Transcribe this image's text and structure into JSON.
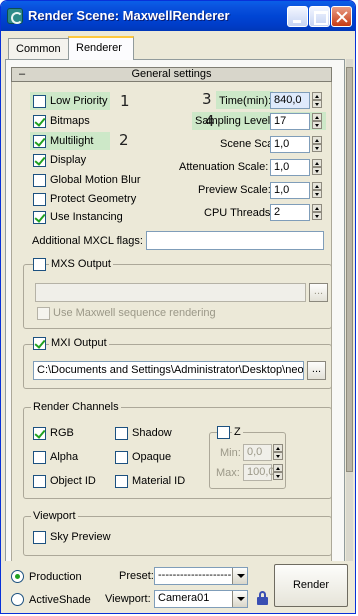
{
  "window": {
    "title": "Render Scene: MaxwellRenderer"
  },
  "tabs": [
    "Common",
    "Renderer"
  ],
  "rollout": {
    "collapse_symbol": "–",
    "title": "General settings"
  },
  "general": {
    "checkboxes": [
      {
        "label": "Low Priority",
        "checked": false
      },
      {
        "label": "Bitmaps",
        "checked": true
      },
      {
        "label": "Multilight",
        "checked": true
      },
      {
        "label": "Display",
        "checked": true
      },
      {
        "label": "Global Motion Blur",
        "checked": false
      },
      {
        "label": "Protect Geometry",
        "checked": false
      },
      {
        "label": "Use Instancing",
        "checked": true
      }
    ],
    "annotations": [
      "1",
      "2",
      "3",
      "4"
    ],
    "params": [
      {
        "label": "Time(min):",
        "value": "840,0"
      },
      {
        "label": "Sampling Level:",
        "value": "17"
      },
      {
        "label": "Scene Scale:",
        "value": "1,0"
      },
      {
        "label": "Attenuation Scale:",
        "value": "1,0"
      },
      {
        "label": "Preview Scale:",
        "value": "1,0"
      },
      {
        "label": "CPU Threads:",
        "value": "2"
      }
    ],
    "mxcl_label": "Additional MXCL flags:",
    "mxcl_value": ""
  },
  "mxs": {
    "label": "MXS Output",
    "checked": false,
    "path": "",
    "browse": "...",
    "sequence_label": "Use Maxwell sequence rendering"
  },
  "mxi": {
    "label": "MXI Output",
    "checked": true,
    "path": "C:\\Documents and Settings\\Administrator\\Desktop\\neo",
    "browse": "..."
  },
  "channels": {
    "title": "Render Channels",
    "items": [
      {
        "label": "RGB",
        "checked": true
      },
      {
        "label": "Shadow",
        "checked": false
      },
      {
        "label": "Alpha",
        "checked": false
      },
      {
        "label": "Opaque",
        "checked": false
      },
      {
        "label": "Object ID",
        "checked": false
      },
      {
        "label": "Material ID",
        "checked": false
      }
    ],
    "z": {
      "label": "Z",
      "checked": false,
      "min_label": "Min:",
      "min_value": "0,0",
      "max_label": "Max:",
      "max_value": "100,0"
    }
  },
  "viewport_group": {
    "title": "Viewport",
    "sky_preview": "Sky Preview",
    "checked": false
  },
  "bottom": {
    "production": "Production",
    "activeshade": "ActiveShade",
    "preset_label": "Preset:",
    "preset_value": "--------------------",
    "viewport_label": "Viewport:",
    "viewport_value": "Camera01",
    "render_button": "Render"
  }
}
